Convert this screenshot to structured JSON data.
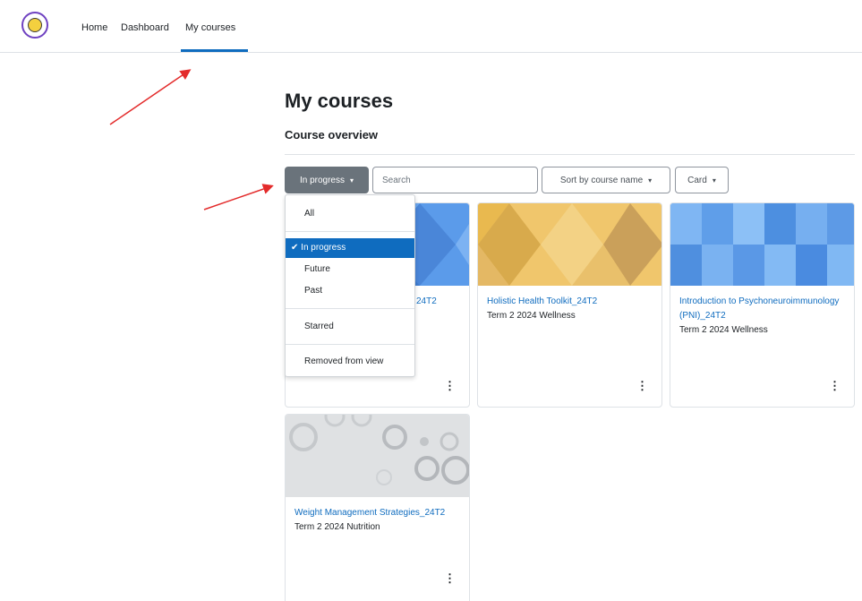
{
  "nav": {
    "items": [
      {
        "label": "Home"
      },
      {
        "label": "Dashboard"
      },
      {
        "label": "My courses",
        "active": true
      }
    ]
  },
  "page": {
    "title": "My courses",
    "section_title": "Course overview"
  },
  "controls": {
    "filter_label": "In progress",
    "search_placeholder": "Search",
    "sort_label": "Sort by course name",
    "view_label": "Card"
  },
  "filter_menu": {
    "items": [
      {
        "label": "All"
      },
      {
        "label": "In progress",
        "selected": true
      },
      {
        "label": "Future"
      },
      {
        "label": "Past"
      },
      {
        "label": "Starred"
      },
      {
        "label": "Removed from view"
      }
    ]
  },
  "courses": [
    {
      "name": "24T2",
      "category": ""
    },
    {
      "name": "Holistic Health Toolkit_24T2",
      "category": "Term 2 2024 Wellness"
    },
    {
      "name": "Introduction to Psychoneuroimmunology (PNI)_24T2",
      "category": "Term 2 2024 Wellness"
    },
    {
      "name": "Weight Management Strategies_24T2",
      "category": "Term 2 2024 Nutrition"
    }
  ],
  "colors": {
    "accent": "#0f6cbf",
    "filter_button": "#6a737b",
    "annotation_arrow": "#e32b2b"
  },
  "icons": {
    "logo": "site-logo-icon",
    "check": "check-icon",
    "caret": "chevron-down-icon",
    "menu": "kebab-menu-icon"
  }
}
